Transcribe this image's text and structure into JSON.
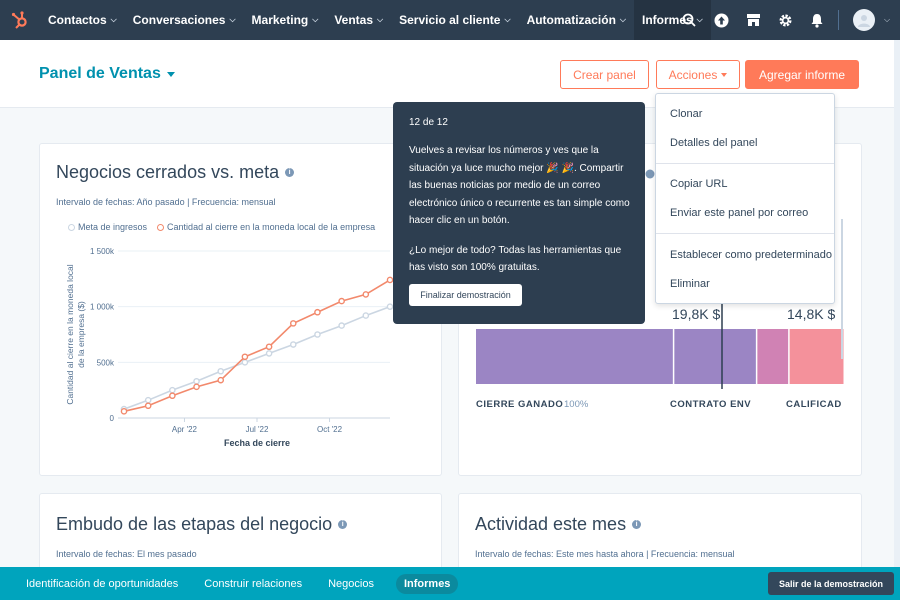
{
  "nav": {
    "items": [
      {
        "label": "Contactos"
      },
      {
        "label": "Conversaciones"
      },
      {
        "label": "Marketing"
      },
      {
        "label": "Ventas"
      },
      {
        "label": "Servicio al cliente"
      },
      {
        "label": "Automatización"
      },
      {
        "label": "Informes"
      }
    ],
    "icons": [
      "search-icon",
      "upgrade-icon",
      "marketplace-icon",
      "settings-icon",
      "notifications-icon"
    ]
  },
  "header": {
    "title": "Panel de Ventas",
    "create_dashboard": "Crear panel",
    "actions": "Acciones",
    "add_report": "Agregar informe"
  },
  "card_closed": {
    "title": "Negocios cerrados vs. meta",
    "meta": "Intervalo de fechas: Año pasado | Frecuencia: mensual"
  },
  "card_funnel": {
    "title": "Embudo de las etapas del negocio",
    "meta": "Intervalo de fechas: El mes pasado"
  },
  "card_activity": {
    "title": "Actividad este mes",
    "meta": "Intervalo de fechas: Este mes hasta ahora | Frecuencia: mensual"
  },
  "chart_data": [
    {
      "type": "line",
      "legend_placement": "top-left",
      "xlabel": "Fecha de cierre",
      "ylabel": "Cantidad al cierre en la moneda local de la empresa ($)",
      "ylim": [
        0,
        1500000
      ],
      "yticks": [
        "0",
        "500k",
        "1 000k",
        "1 500k"
      ],
      "xticks": [
        "Apr '22",
        "Jul '22",
        "Oct '22"
      ],
      "x": [
        1,
        2,
        3,
        4,
        5,
        6,
        7,
        8,
        9,
        10,
        11,
        12
      ],
      "series": [
        {
          "name": "Meta de ingresos",
          "color": "#cbd6e2",
          "values": [
            80000,
            160000,
            250000,
            330000,
            420000,
            500000,
            580000,
            660000,
            750000,
            830000,
            920000,
            1000000
          ]
        },
        {
          "name": "Cantidad al cierre en la moneda local de la empresa",
          "color": "#f2896c",
          "values": [
            60000,
            110000,
            200000,
            280000,
            340000,
            550000,
            640000,
            850000,
            950000,
            1050000,
            1110000,
            1240000
          ]
        }
      ]
    },
    {
      "type": "bar",
      "orientation": "horizontal-stacked",
      "value_labels": [
        "19,8K $",
        "14,8K $"
      ],
      "categories": [
        "CIERRE GANADO",
        "CONTRATO ENV",
        "CALIFICAD"
      ],
      "category_suffix": "100%",
      "segments": [
        {
          "value": 43,
          "color": "#9b85c4"
        },
        {
          "value": 18,
          "color": "#9b85c4"
        },
        {
          "value": 7,
          "color": "#d082b4"
        },
        {
          "value": 12,
          "color": "#f4919b"
        }
      ]
    }
  ],
  "dropdown": {
    "items": [
      "Clonar",
      "Detalles del panel",
      "Copiar URL",
      "Enviar este panel por correo",
      "Establecer como predeterminado",
      "Eliminar"
    ]
  },
  "tooltip": {
    "step": "12 de 12",
    "p1": "Vuelves a revisar los números y ves que la situación ya luce mucho mejor 🎉 🎉. Compartir las buenas noticias por medio de un correo electrónico único o recurrente es tan simple como hacer clic en un botón.",
    "p2": "¿Lo mejor de todo? Todas las herramientas que has visto son 100% gratuitas.",
    "finish": "Finalizar demostración"
  },
  "bottombar": {
    "items": [
      "Identificación de oportunidades",
      "Construir relaciones",
      "Negocios",
      "Informes"
    ],
    "exit": "Salir de la demostración"
  },
  "colors": {
    "nav_bg": "#2d3e50",
    "accent": "#ff7a59",
    "teal": "#00a4bd",
    "title": "#0091ae"
  }
}
